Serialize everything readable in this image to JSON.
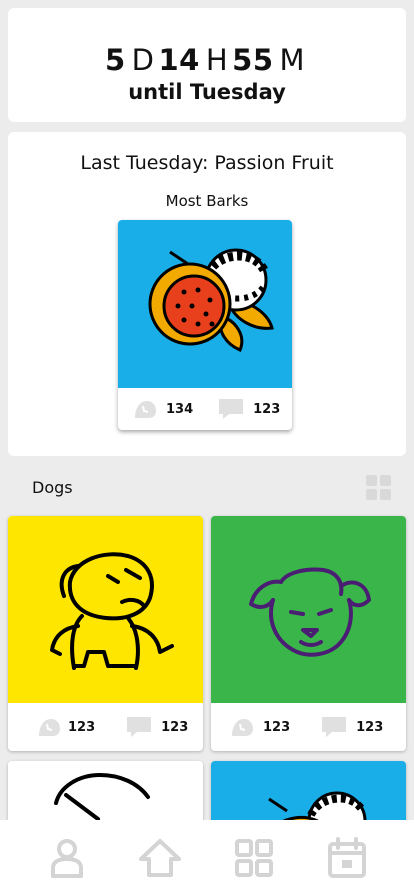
{
  "countdown": {
    "days": "5",
    "days_unit": "D",
    "hours": "14",
    "hours_unit": "H",
    "minutes": "55",
    "minutes_unit": "M",
    "until_label": "until Tuesday"
  },
  "last": {
    "title": "Last Tuesday: Passion Fruit",
    "subtitle": "Most Barks",
    "featured": {
      "art": "passion-fruit-drawing",
      "background": "#1aaee9",
      "barks": "134",
      "comments": "123"
    }
  },
  "dogs_section": {
    "title": "Dogs",
    "view_icon": "grid-icon"
  },
  "dogs": [
    {
      "art": "yellow-dog-drawing",
      "background": "#ffe600",
      "barks": "123",
      "comments": "123"
    },
    {
      "art": "green-dog-drawing",
      "background": "#3ab54a",
      "barks": "123",
      "comments": "123"
    },
    {
      "art": "white-sketch-drawing",
      "background": "#ffffff",
      "barks": "",
      "comments": ""
    },
    {
      "art": "blue-fruit-drawing",
      "background": "#1aaee9",
      "barks": "",
      "comments": ""
    }
  ],
  "tabbar": {
    "items": [
      "profile-icon",
      "home-icon",
      "grid-icon",
      "calendar-icon"
    ]
  }
}
